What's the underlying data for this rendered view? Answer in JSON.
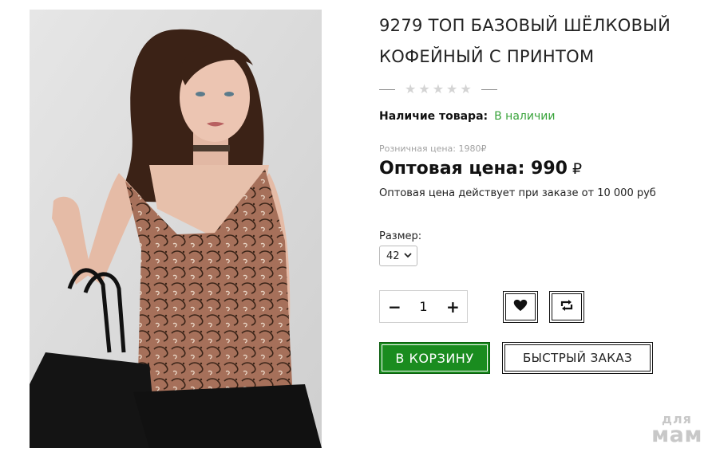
{
  "product": {
    "title_line1": "9279 ТОП БАЗОВЫЙ ШЁЛКОВЫЙ",
    "title_line2": "КОФЕЙНЫЙ С ПРИНТОМ",
    "rating_stars": 0,
    "rating_max": 5
  },
  "availability": {
    "label": "Наличие товара:",
    "value": "В наличии"
  },
  "pricing": {
    "retail": "Розничная цена: 1980₽",
    "wholesale": "Оптовая цена: 990",
    "currency": "₽",
    "wholesale_note": "Оптовая цена действует при заказе от 10 000 руб"
  },
  "size": {
    "label": "Размер:",
    "selected": "42"
  },
  "quantity": {
    "minus": "−",
    "value": "1",
    "plus": "+"
  },
  "actions": {
    "cart": "В КОРЗИНУ",
    "quick_order": "БЫСТРЫЙ ЗАКАЗ",
    "favorite_icon": "heart-icon",
    "compare_icon": "compare-icon"
  },
  "watermark": {
    "line1": "для",
    "line2": "мам"
  },
  "colors": {
    "accent_green": "#1a8c1f",
    "in_stock": "#38a33a",
    "muted": "#a3a3a3",
    "star_empty": "#d4d4d4"
  }
}
